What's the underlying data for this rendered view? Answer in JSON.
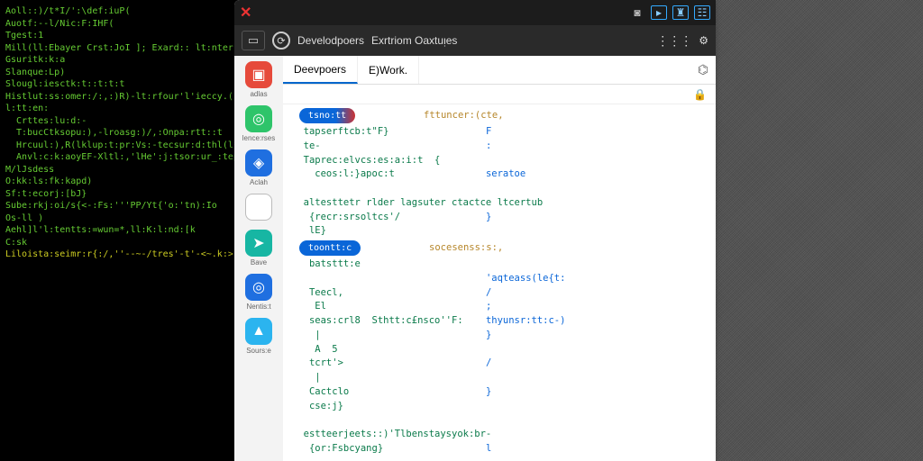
{
  "terminal": {
    "lines": [
      "Aoll::)/t*I/':\\def:iuP(",
      "Auotf:--l/Nic:F:IHF(",
      "Tgest:1",
      "Mill(ll:Ebayer Crst:JoI ]; Exard:: lt:nter",
      "Gsuritk:k:a",
      "Slanque:Lp)",
      "Slougl:iesctk:t::t:t:t",
      "Histlut:ss:omer:/:,:)R)-lt:rfour'l'ieccy.(':{:-{",
      "l:tt:en:",
      "  Crttes:lu:d:-",
      "  T:bucCtksopu:),-lroasg:)/,:Onpa:rtt::t",
      "  Hrcuul:),R(lklup:t:pr:Vs:-tecsur:d:thl(l*}",
      "  Anvl:c:k:aoyEF-Xltl:,'lHe':j:tsor:ur_:tep>:t",
      "M/lJsdess",
      "O:kk:ls:fk:kapd)",
      "Sf:t:ecorj:[bJ}",
      "Sube:rkj:oi/s{<-:Fs:'''PP/Yt{'o:'tn):Io",
      "Os-ll )",
      "Aehl]l'l:tentts:=wun=*,ll:K:l:nd:[k",
      "C:sk",
      "",
      "Liloista:seimr:r{:/,''--~-/tres'-t'-<~.k:>:-{:{:"
    ]
  },
  "titlebar": {
    "icons": [
      "camera",
      "arrow",
      "castle",
      "window"
    ]
  },
  "toolbar": {
    "title_a": "Develodpoers",
    "title_b": "Exrtriom Oaxtuᴉes"
  },
  "sidebar": {
    "items": [
      {
        "label": "adlas",
        "color": "#e64a3b",
        "glyph": "▣"
      },
      {
        "label": "lence:rses",
        "color": "#2ec46a",
        "glyph": "◎"
      },
      {
        "label": "Aclah",
        "color": "#1f6fe0",
        "glyph": "◈"
      },
      {
        "label": "",
        "color": "#ffffff",
        "glyph": ""
      },
      {
        "label": "Bave",
        "color": "#17b6a3",
        "glyph": "➤"
      },
      {
        "label": "Nentis:t",
        "color": "#1f6fe0",
        "glyph": "◎"
      },
      {
        "label": "Sours:e",
        "color": "#2bb4ef",
        "glyph": "▲"
      }
    ]
  },
  "subtabs": {
    "a": "Deevpoers",
    "b": "E)Work."
  },
  "code": {
    "pill1": "tsno:tt",
    "pill1_right": "fttuncer:(cte,",
    "block1": [
      {
        "l": "  tapserftcb:t\"F}",
        "r": "F"
      },
      {
        "l": "  te-",
        "r": ":"
      },
      {
        "l": "  Taprec:elvcs:es:a:i:t  {",
        "r": ""
      },
      {
        "l": "    ceos:l:}apoc:t",
        "r": "seratoe"
      },
      {
        "l": "",
        "r": ""
      },
      {
        "l": "  altesttetr rlder lagsuter ctactce ltcertub",
        "r": ""
      },
      {
        "l": "   {recr:srsoltcs'/",
        "r": "}"
      },
      {
        "l": "   lE}",
        "r": ""
      }
    ],
    "pill2": "toontt:c",
    "pill2_right": "socesenss:s:,",
    "block2": [
      {
        "l": "   batsttt:e",
        "r": ""
      },
      {
        "l": "",
        "r": "'aqteass(le{t:"
      },
      {
        "l": "   Teecl,",
        "r": "/"
      },
      {
        "l": "    El",
        "r": ";"
      },
      {
        "l": "   seas:crl8  Sthtt:c£nsco''F:",
        "r": "thyunsr:tt:c-)"
      },
      {
        "l": "    |",
        "r": "}"
      },
      {
        "l": "    A  5",
        "r": ""
      },
      {
        "l": "   tcrt'>",
        "r": "/"
      },
      {
        "l": "    |",
        "r": ""
      },
      {
        "l": "   Cactclo",
        "r": "}"
      },
      {
        "l": "   cse:j}",
        "r": ""
      },
      {
        "l": "",
        "r": ""
      },
      {
        "l": "  estteerjeets::)'Tlbenstaysyok:br-",
        "r": ""
      },
      {
        "l": "   {or:Fsbcyang}",
        "r": "l"
      }
    ]
  }
}
